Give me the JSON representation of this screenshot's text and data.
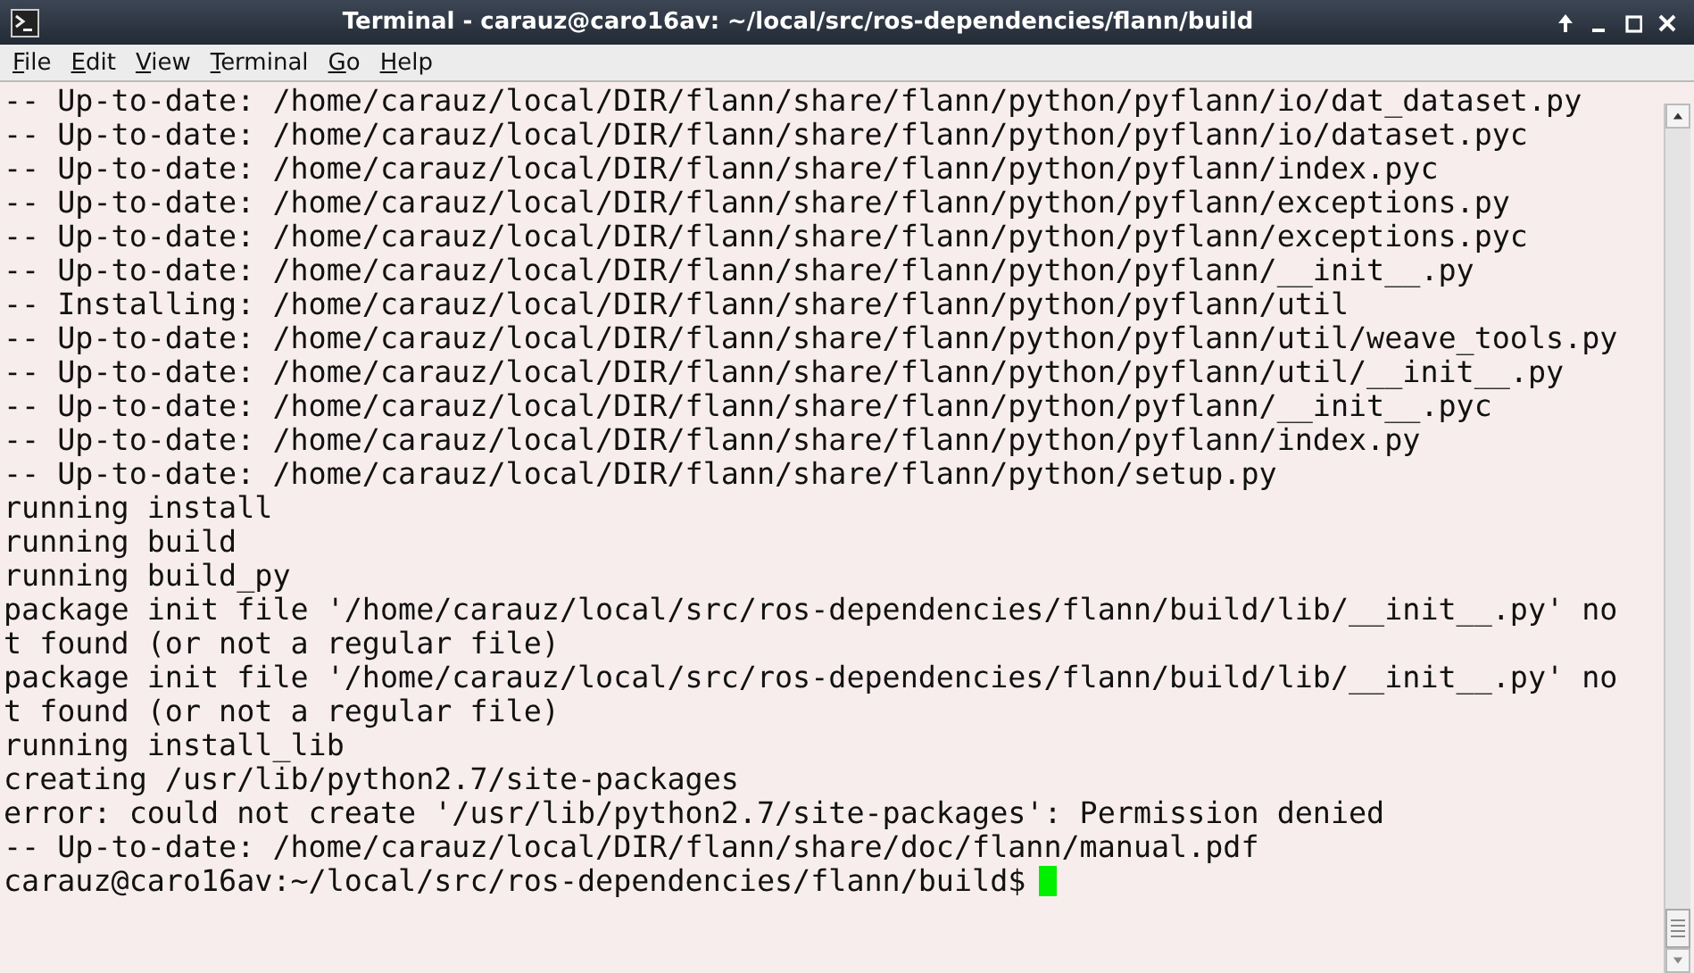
{
  "window": {
    "title": "Terminal - carauz@caro16av: ~/local/src/ros-dependencies/flann/build"
  },
  "menu": [
    "File",
    "Edit",
    "View",
    "Terminal",
    "Go",
    "Help"
  ],
  "terminal": {
    "lines": [
      "-- Up-to-date: /home/carauz/local/DIR/flann/share/flann/python/pyflann/io/dat_dataset.py",
      "-- Up-to-date: /home/carauz/local/DIR/flann/share/flann/python/pyflann/io/dataset.pyc",
      "-- Up-to-date: /home/carauz/local/DIR/flann/share/flann/python/pyflann/index.pyc",
      "-- Up-to-date: /home/carauz/local/DIR/flann/share/flann/python/pyflann/exceptions.py",
      "-- Up-to-date: /home/carauz/local/DIR/flann/share/flann/python/pyflann/exceptions.pyc",
      "-- Up-to-date: /home/carauz/local/DIR/flann/share/flann/python/pyflann/__init__.py",
      "-- Installing: /home/carauz/local/DIR/flann/share/flann/python/pyflann/util",
      "-- Up-to-date: /home/carauz/local/DIR/flann/share/flann/python/pyflann/util/weave_tools.py",
      "-- Up-to-date: /home/carauz/local/DIR/flann/share/flann/python/pyflann/util/__init__.py",
      "-- Up-to-date: /home/carauz/local/DIR/flann/share/flann/python/pyflann/__init__.pyc",
      "-- Up-to-date: /home/carauz/local/DIR/flann/share/flann/python/pyflann/index.py",
      "-- Up-to-date: /home/carauz/local/DIR/flann/share/flann/python/setup.py",
      "running install",
      "running build",
      "running build_py",
      "package init file '/home/carauz/local/src/ros-dependencies/flann/build/lib/__init__.py' no",
      "t found (or not a regular file)",
      "package init file '/home/carauz/local/src/ros-dependencies/flann/build/lib/__init__.py' no",
      "t found (or not a regular file)",
      "running install_lib",
      "creating /usr/lib/python2.7/site-packages",
      "error: could not create '/usr/lib/python2.7/site-packages': Permission denied",
      "-- Up-to-date: /home/carauz/local/DIR/flann/share/doc/flann/manual.pdf"
    ],
    "prompt": "carauz@caro16av:~/local/src/ros-dependencies/flann/build$"
  }
}
